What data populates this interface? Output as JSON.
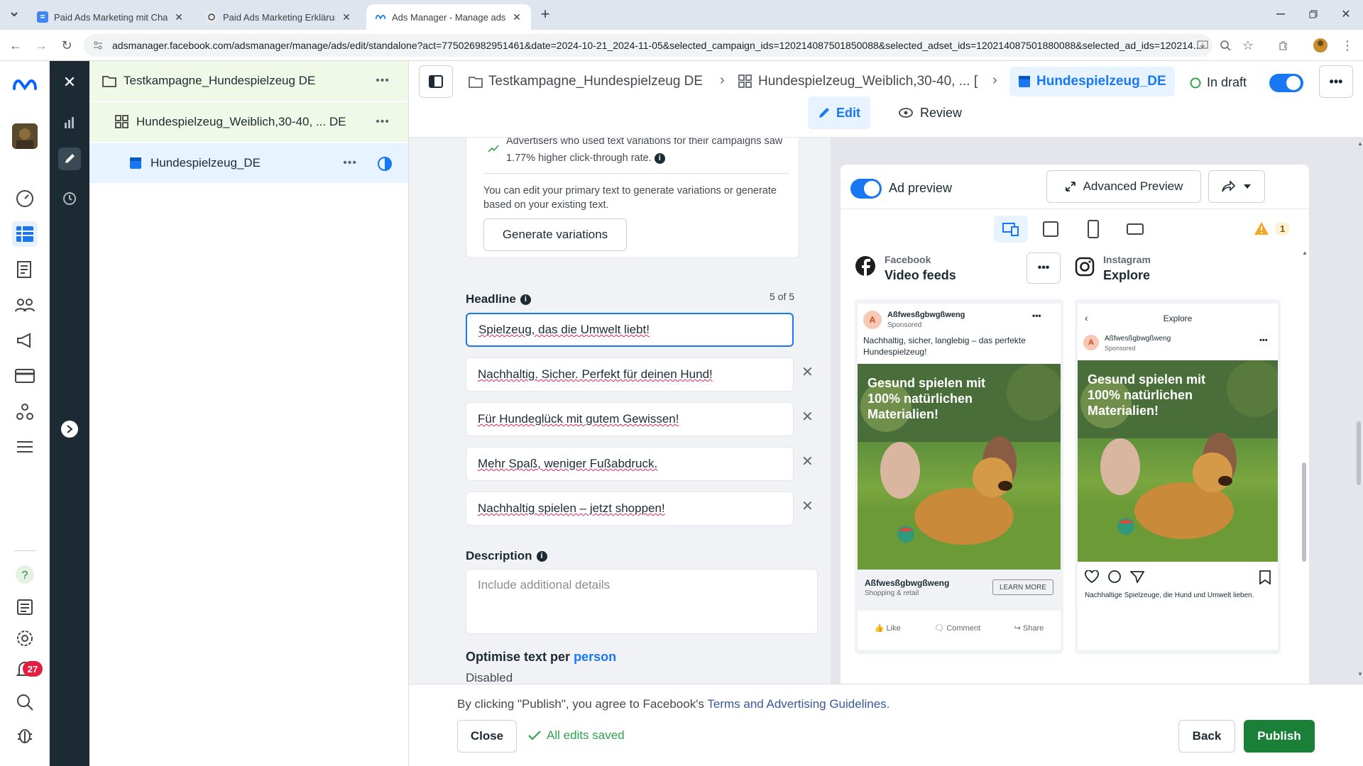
{
  "browser": {
    "tabs": [
      {
        "title": "Paid Ads Marketing mit ChatGP",
        "active": false
      },
      {
        "title": "Paid Ads Marketing Erklärung",
        "active": false
      },
      {
        "title": "Ads Manager - Manage ads - A",
        "active": true
      }
    ],
    "url": "adsmanager.facebook.com/adsmanager/manage/ads/edit/standalone?act=775026982951461&date=2024-10-21_2024-11-05&selected_campaign_ids=120214087501850088&selected_adset_ids=120214087501880088&selected_ad_ids=120214..."
  },
  "metanav": {
    "notification_count": "27"
  },
  "tree": {
    "campaign": "Testkampagne_Hundespielzeug DE",
    "adset": "Hundespielzeug_Weiblich,30-40, ... DE",
    "ad": "Hundespielzeug_DE"
  },
  "header": {
    "crumb_campaign": "Testkampagne_Hundespielzeug DE",
    "crumb_adset": "Hundespielzeug_Weiblich,30-40, ... [",
    "crumb_ad": "Hundespielzeug_DE",
    "status": "In draft",
    "edit_label": "Edit",
    "review_label": "Review"
  },
  "editor": {
    "tip_text": "Advertisers who used text variations for their campaigns saw 1.77% higher click-through rate.",
    "variation_info": "You can edit your primary text to generate variations or generate based on your existing text.",
    "generate_label": "Generate variations",
    "headline_label": "Headline",
    "headline_count": "5 of 5",
    "headlines": [
      "Spielzeug, das die Umwelt liebt!",
      "Nachhaltig. Sicher. Perfekt für deinen Hund!",
      "Für Hundeglück mit gutem Gewissen!",
      "Mehr Spaß, weniger Fußabdruck.",
      "Nachhaltig spielen – jetzt shoppen!"
    ],
    "description_label": "Description",
    "description_placeholder": "Include additional details",
    "optimise_label": "Optimise text per",
    "optimise_link": "person",
    "optimise_value": "Disabled"
  },
  "preview": {
    "toggle_label": "Ad preview",
    "advanced_label": "Advanced Preview",
    "warning_count": "1",
    "fb_platform": "Facebook",
    "fb_placement": "Video feeds",
    "ig_platform": "Instagram",
    "ig_placement": "Explore",
    "page_name": "Aßfwesßgbwgßweng",
    "sponsored": "Sponsored",
    "primary_text": "Nachhaltig, sicher, langlebig – das perfekte Hundespielzeug!",
    "image_text": "Gesund spielen mit 100% natürlichen Materialien!",
    "category": "Shopping & retail",
    "cta": "LEARN MORE",
    "like": "Like",
    "comment": "Comment",
    "share": "Share",
    "ig_header": "Explore",
    "ig_caption": "Nachhaltige Spielzeuge, die Hund und Umwelt lieben."
  },
  "footer": {
    "terms_prefix": "By clicking \"Publish\", you agree to Facebook's",
    "terms_link": "Terms and Advertising Guidelines.",
    "close_label": "Close",
    "saved_label": "All edits saved",
    "back_label": "Back",
    "publish_label": "Publish"
  },
  "colors": {
    "accent": "#1877f2",
    "publish": "#1a7f37",
    "sidebar_dark": "#1c2b33",
    "tree_highlight": "#f0f9e8"
  }
}
